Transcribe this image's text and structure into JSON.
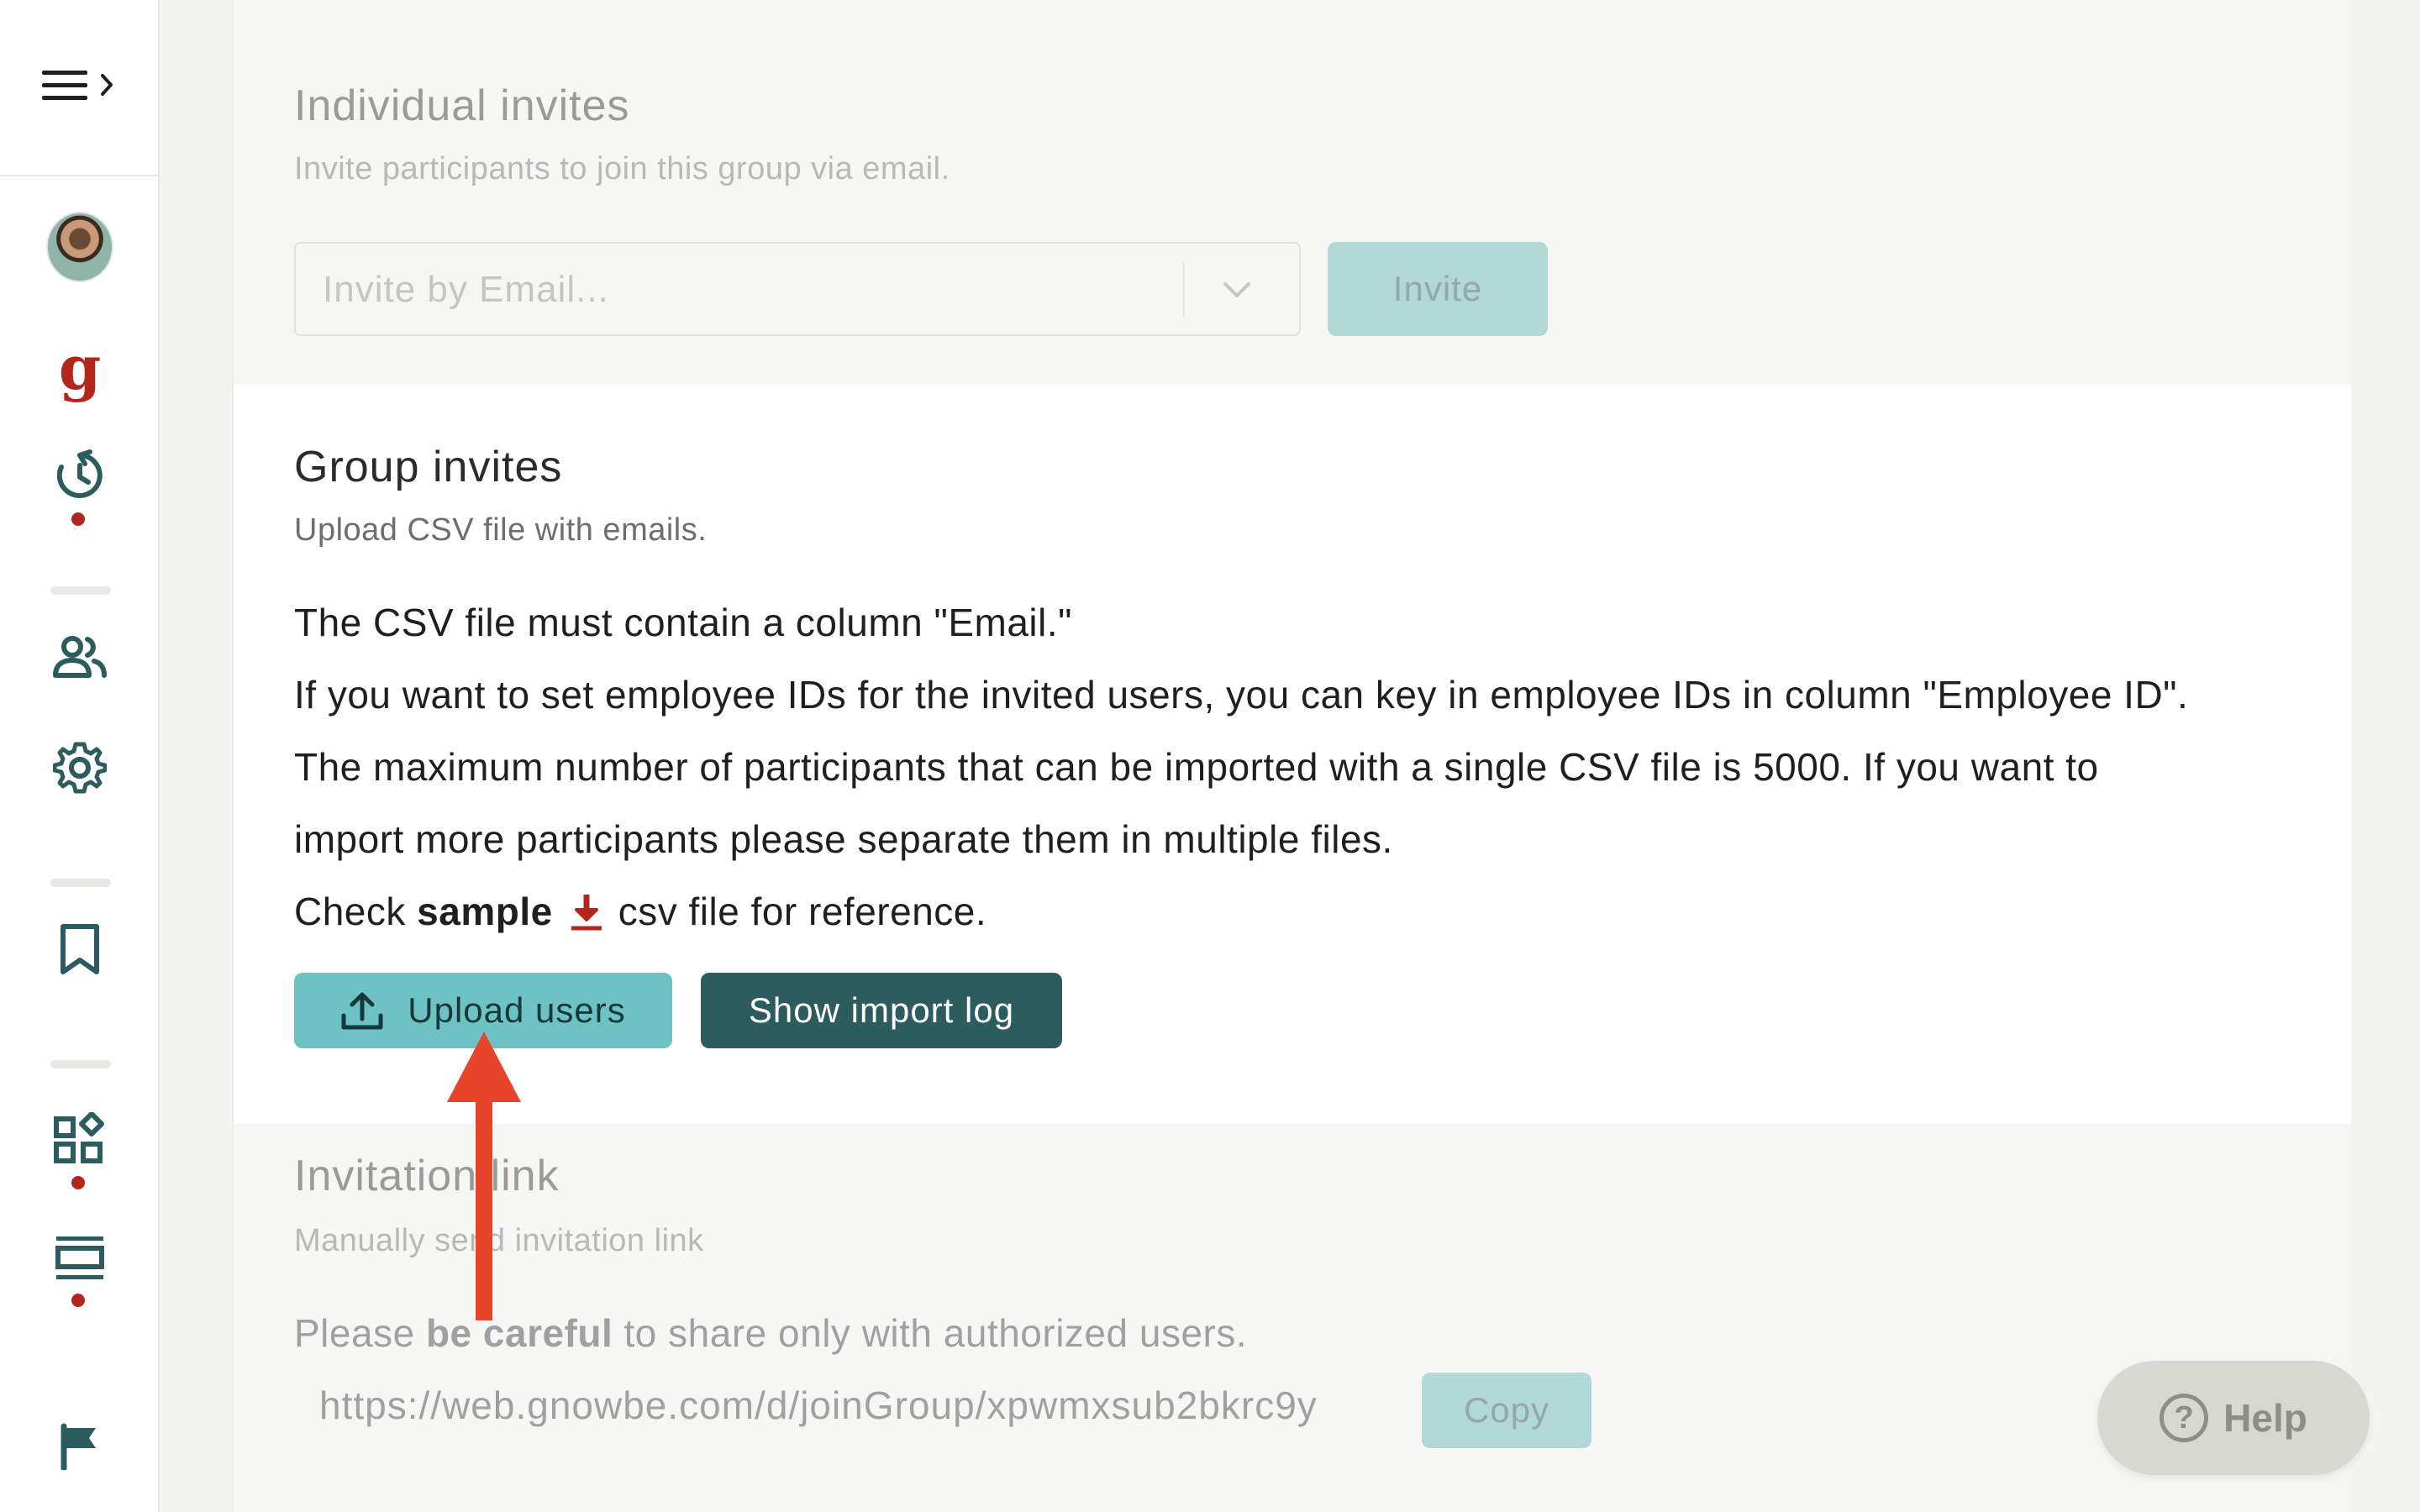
{
  "sidebar": {
    "menu_icon": "menu-expand-icon",
    "items": [
      {
        "icon": "user-avatar",
        "dot": false
      },
      {
        "icon": "gnowbe-logo-icon",
        "glyph": "g",
        "dot": false
      },
      {
        "icon": "history-icon",
        "dot": true
      },
      {
        "icon": "users-icon",
        "dot": false
      },
      {
        "icon": "gear-icon",
        "dot": false
      },
      {
        "icon": "bookmark-icon",
        "dot": false
      },
      {
        "icon": "apps-icon",
        "dot": true
      },
      {
        "icon": "layout-icon",
        "dot": true
      },
      {
        "icon": "flag-icon",
        "dot": false
      }
    ],
    "accent_color": "#b3261e",
    "icon_color": "#2d5c5e"
  },
  "individual_invites": {
    "title": "Individual invites",
    "subtitle": "Invite participants to join this group via email.",
    "email_placeholder": "Invite by Email...",
    "invite_label": "Invite"
  },
  "group_invites": {
    "title": "Group invites",
    "subtitle": "Upload CSV file with emails.",
    "line1": "The CSV file must contain a column \"Email.\"",
    "line2": "If you want to set employee IDs for the invited users, you can key in employee IDs in column \"Employee ID\".",
    "line3": "The maximum number of participants that can be imported with a single CSV file is 5000. If you want to",
    "line4": "import more participants please separate them in multiple files.",
    "check_prefix": "Check",
    "sample_link": "sample",
    "check_suffix": "csv file for reference.",
    "upload_label": "Upload users",
    "log_label": "Show import log"
  },
  "invitation_link": {
    "title": "Invitation link",
    "subtitle": "Manually send invitation link",
    "warning_prefix": "Please",
    "warning_bold": "be careful",
    "warning_suffix": "to share only with authorized users.",
    "url": "https://web.gnowbe.com/d/joinGroup/xpwmxsub2bkrc9y",
    "copy_label": "Copy"
  },
  "help": {
    "label": "Help",
    "icon_glyph": "?"
  },
  "colors": {
    "teal_light": "#6fc2c4",
    "teal_dark": "#2d5c5e",
    "annotation_arrow": "#e8442c"
  }
}
